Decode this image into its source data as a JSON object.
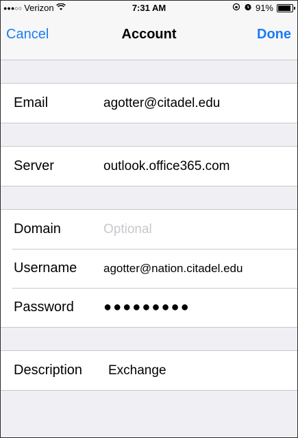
{
  "status_bar": {
    "signal": "●●●○○",
    "carrier": "Verizon",
    "time": "7:31 AM",
    "battery": "91%"
  },
  "nav": {
    "cancel": "Cancel",
    "title": "Account",
    "done": "Done"
  },
  "fields": {
    "email_label": "Email",
    "email_value": "agotter@citadel.edu",
    "server_label": "Server",
    "server_value": "outlook.office365.com",
    "domain_label": "Domain",
    "domain_placeholder": "Optional",
    "username_label": "Username",
    "username_value": "agotter@nation.citadel.edu",
    "password_label": "Password",
    "password_value": "●●●●●●●●●",
    "description_label": "Description",
    "description_value": "Exchange"
  },
  "colors": {
    "accent": "#1b7cf5",
    "background": "#efeff4",
    "separator": "#c8c7cc"
  }
}
